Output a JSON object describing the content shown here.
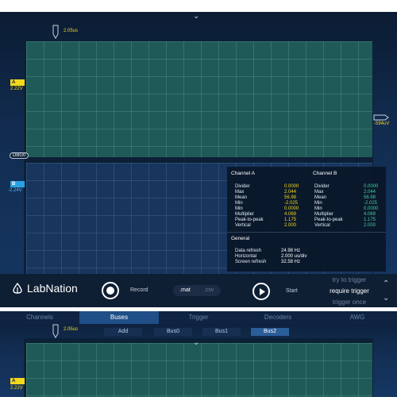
{
  "top": {
    "chevron": "⌄",
    "time_marker": "2.05us",
    "channel_a_marker": "A",
    "channel_a_offset": "2.22V",
    "channel_b_marker": "B",
    "channel_b_offset": "-2.24V",
    "trigger_level": "-594uV",
    "ground_tag": "DBG0",
    "stats": {
      "channel_a_title": "Channel A",
      "channel_b_title": "Channel B",
      "rows": [
        {
          "name": "Divider",
          "a": "0.0000",
          "b": "0.0000"
        },
        {
          "name": "Max",
          "a": "2.044",
          "b": "2.044"
        },
        {
          "name": "Mean",
          "a": "56.98",
          "b": "56.98"
        },
        {
          "name": "Min",
          "a": "-2.025",
          "b": "-2.025"
        },
        {
          "name": "Min",
          "a": "0.0000",
          "b": "0.0000"
        },
        {
          "name": "Multiplier",
          "a": "4.069",
          "b": "4.069"
        },
        {
          "name": "Peak-to-peak",
          "a": "1.175",
          "b": "1.175"
        },
        {
          "name": "Vertical",
          "a": "2.000",
          "b": "2.000"
        }
      ],
      "general_title": "General",
      "general": [
        {
          "name": "Data refresh",
          "value": "24.98 Hz"
        },
        {
          "name": "Horizontal",
          "value": "2.000 us/div"
        },
        {
          "name": "Screen refresh",
          "value": "32.58 Hz"
        }
      ]
    },
    "toolbar": {
      "logo_text": "LabNation",
      "record_label": "Record",
      "format_mat": ".mat",
      "format_csv": ".csv",
      "start_label": "Start",
      "trigger_options": [
        "try to trigger",
        "require trigger",
        "trigger once"
      ],
      "up_icon": "⌃",
      "down_icon": "⌄"
    }
  },
  "bottom": {
    "tabs": [
      "Channels",
      "Buses",
      "Trigger",
      "Decoders",
      "AWG"
    ],
    "active_tab": "Buses",
    "bus_buttons": [
      "Add",
      "Bus0",
      "Bus1",
      "Bus2"
    ],
    "time_marker": "2.05us",
    "channel_a_marker": "A",
    "channel_a_offset": "2.22V",
    "chevron": "⌄"
  },
  "colors": {
    "channel_a": "#f2d71d",
    "channel_b": "#59b7ef",
    "channel_b_stats": "#3fd29a"
  }
}
